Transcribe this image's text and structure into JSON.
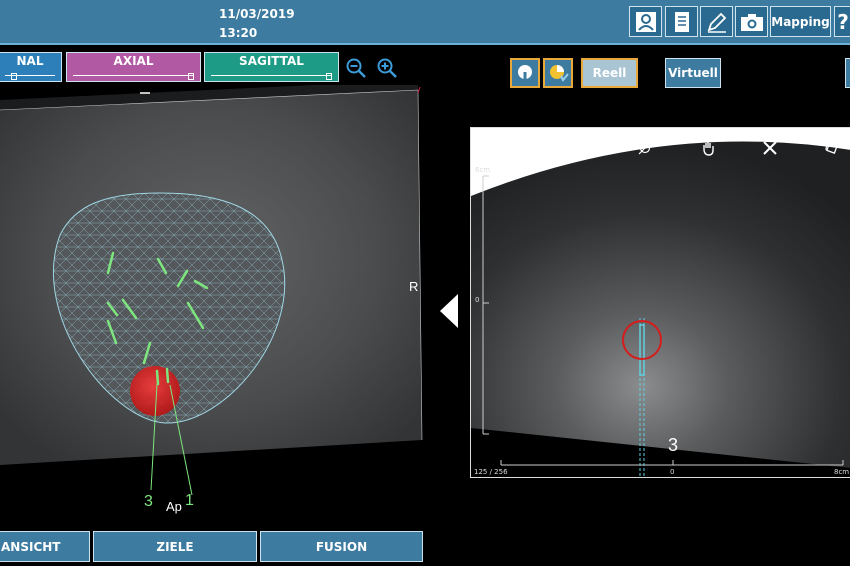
{
  "header": {
    "date": "11/03/2019",
    "time": "13:20",
    "mapping_label": "Mapping",
    "help_label": "?"
  },
  "view_tabs": [
    {
      "label": "NAL",
      "color": "#2c7fb8"
    },
    {
      "label": "AXIAL",
      "color": "#b259a3"
    },
    {
      "label": "SAGITTAL",
      "color": "#1e9b86"
    }
  ],
  "mode": {
    "reell_label": "Reell",
    "virtuell_label": "Virtuell"
  },
  "left_view": {
    "orientation_label": "R",
    "annotation_ap": "Ap",
    "annotation_3": "3",
    "annotation_1": "1"
  },
  "ultrasound": {
    "depth_top": "6cm",
    "depth_zero": "0",
    "frame_counter": "125 / 256",
    "x_zero": "0",
    "x_max": "8cm",
    "needle_label": "3"
  },
  "bottom_buttons": {
    "ansicht": "ANSICHT",
    "ziele": "ZIELE",
    "fusion": "FUSION"
  },
  "colors": {
    "toolbar": "#3d7ca0",
    "accent": "#e8a93a",
    "target_circle": "#d61c1c",
    "needle": "#5fd0e0"
  }
}
